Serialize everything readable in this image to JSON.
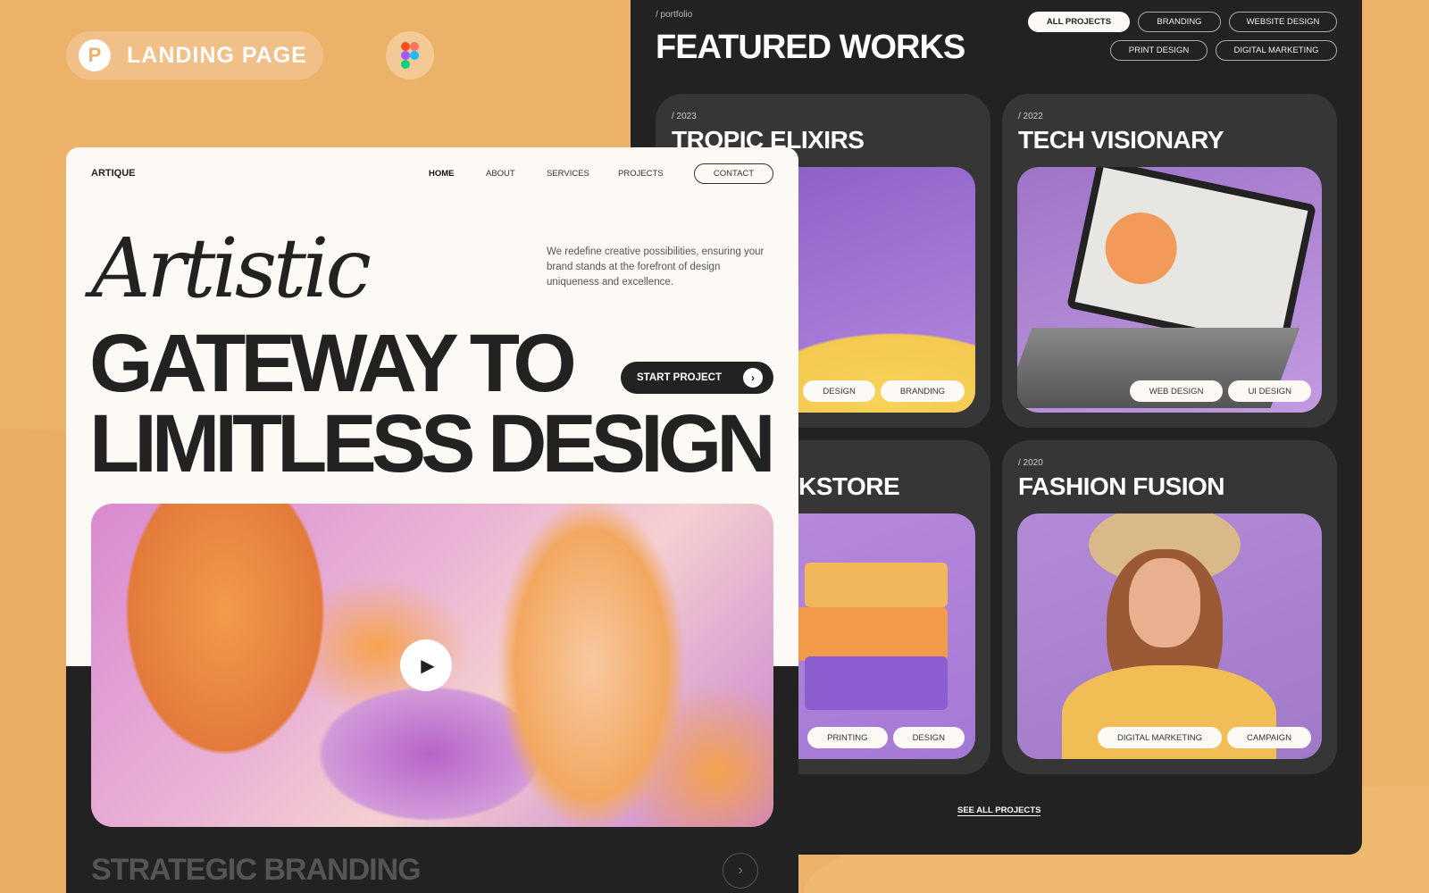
{
  "badge": {
    "label": "LANDING PAGE"
  },
  "portfolio": {
    "crumb": "/ portfolio",
    "title": "FEATURED WORKS",
    "filters": [
      "ALL PROJECTS",
      "BRANDING",
      "WEBSITE DESIGN",
      "PRINT DESIGN",
      "DIGITAL MARKETING"
    ],
    "active_filter": "ALL PROJECTS",
    "cards": [
      {
        "year": "/ 2023",
        "title": "TROPIC ELIXIRS",
        "tags": [
          "DESIGN",
          "BRANDING"
        ]
      },
      {
        "year": "/ 2022",
        "title": "TECH VISIONARY",
        "tags": [
          "WEB DESIGN",
          "UI DESIGN"
        ]
      },
      {
        "year": "",
        "title": "KSTORE",
        "tags": [
          "PRINTING",
          "DESIGN"
        ]
      },
      {
        "year": "/ 2020",
        "title": "FASHION FUSION",
        "tags": [
          "DIGITAL MARKETING",
          "CAMPAIGN"
        ]
      }
    ],
    "see_all": "SEE ALL PROJECTS"
  },
  "landing": {
    "brand": "ARTIQUE",
    "nav": [
      "HOME",
      "ABOUT",
      "SERVICES",
      "PROJECTS"
    ],
    "contact": "CONTACT",
    "script": "Artistic",
    "headline1": "GATEWAY TO",
    "headline2": "LIMITLESS DESIGN",
    "description": "We redefine creative possibilities, ensuring your brand stands at the forefront of design uniqueness and excellence.",
    "start": "START PROJECT",
    "next_section": "STRATEGIC BRANDING"
  },
  "colors": {
    "background": "#ecb26a",
    "panel": "#222222",
    "cream": "#fdfaf5"
  }
}
